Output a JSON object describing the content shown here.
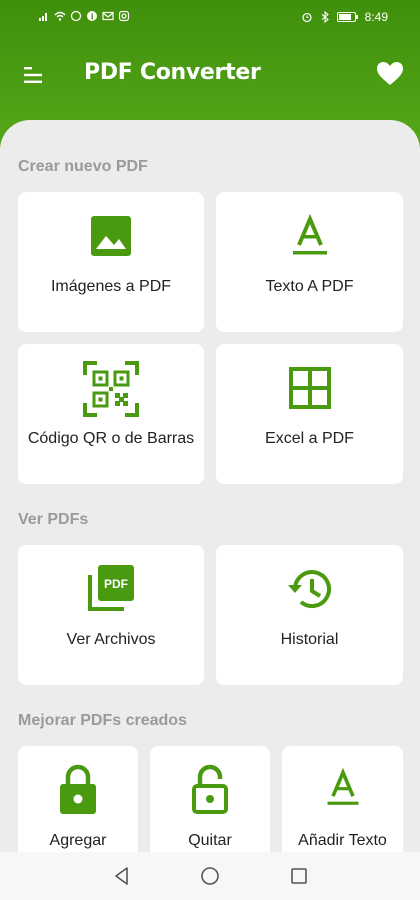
{
  "status": {
    "time": "8:49"
  },
  "app": {
    "title": "PDF Converter"
  },
  "icons": {
    "menu": "menu-icon",
    "favorite": "heart-icon",
    "image": "image-icon",
    "text": "text-format-icon",
    "qr": "qr-scan-icon",
    "grid": "grid-icon",
    "pdf": "pdf-icon",
    "history": "history-icon",
    "lock": "lock-icon",
    "unlock": "lock-open-icon"
  },
  "colors": {
    "accent": "#4a9a10",
    "background": "#ececec",
    "card": "#ffffff"
  },
  "sections": {
    "create": {
      "title": "Crear nuevo PDF",
      "items": [
        "Imágenes a PDF",
        "Texto A PDF",
        "Código QR o de Barras",
        "Excel a PDF"
      ]
    },
    "view": {
      "title": "Ver PDFs",
      "items": [
        "Ver Archivos",
        "Historial"
      ]
    },
    "improve": {
      "title": "Mejorar PDFs creados",
      "items": [
        "Agregar",
        "Quitar",
        "Añadir Texto"
      ]
    }
  }
}
